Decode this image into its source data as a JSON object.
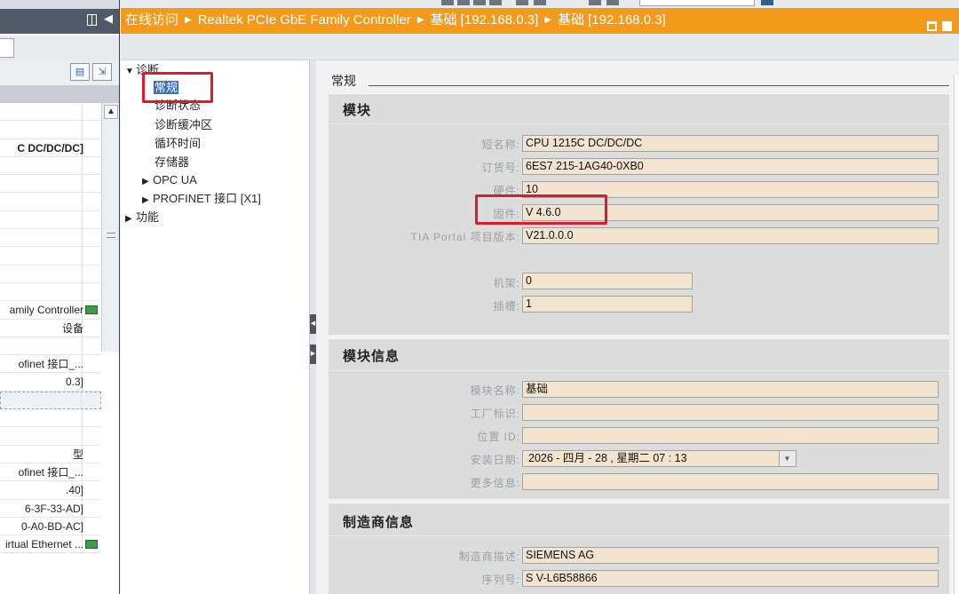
{
  "left_panel": {
    "rows": [
      {
        "text": "",
        "bold": false
      },
      {
        "text": "",
        "bold": false
      },
      {
        "text": "C DC/DC/DC]",
        "bold": true
      },
      {
        "text": "",
        "bold": false
      },
      {
        "text": "",
        "bold": false
      },
      {
        "text": "",
        "bold": false
      },
      {
        "text": "",
        "bold": false
      },
      {
        "text": "",
        "bold": false
      },
      {
        "text": "",
        "bold": false
      },
      {
        "text": "",
        "bold": false
      },
      {
        "text": "",
        "bold": false
      },
      {
        "text": "amily Controller",
        "bold": false,
        "eth": true
      },
      {
        "text": "设备",
        "bold": false
      },
      {
        "text": "",
        "bold": false
      },
      {
        "text": "ofinet 接口_...",
        "bold": false
      },
      {
        "text": "0.3]",
        "bold": false
      },
      {
        "text": "",
        "bold": false,
        "selected": true
      },
      {
        "text": "",
        "bold": false
      },
      {
        "text": "",
        "bold": false
      },
      {
        "text": "型",
        "bold": false
      },
      {
        "text": "ofinet 接口_...",
        "bold": false
      },
      {
        "text": ".40]",
        "bold": false
      },
      {
        "text": "6-3F-33-AD]",
        "bold": false
      },
      {
        "text": "0-A0-BD-AC]",
        "bold": false
      },
      {
        "text": "irtual Ethernet ...",
        "bold": false,
        "eth": true
      }
    ]
  },
  "titlebar": {
    "crumb1": "在线访问",
    "crumb2": "Realtek PCIe GbE Family Controller",
    "crumb3": "基础 [192.168.0.3]",
    "crumb4": "基础 [192.168.0.3]"
  },
  "nav": {
    "diagnostics": "诊断",
    "general": "常规",
    "diag_status": "诊断状态",
    "diag_buffer": "诊断缓冲区",
    "cycle_time": "循环时间",
    "memory": "存储器",
    "opc_ua": "OPC UA",
    "profinet": "PROFINET 接口 [X1]",
    "functions": "功能"
  },
  "content": {
    "section_title": "常规",
    "module": {
      "title": "模块",
      "short_name_label": "短名称:",
      "short_name": "CPU 1215C DC/DC/DC",
      "order_no_label": "订货号:",
      "order_no": "6ES7 215-1AG40-0XB0",
      "hardware_label": "硬件:",
      "hardware": "10",
      "firmware_label": "固件:",
      "firmware": "V 4.6.0",
      "tia_label": "TIA Portal 项目版本:",
      "tia": "V21.0.0.0",
      "rack_label": "机架:",
      "rack": "0",
      "slot_label": "插槽:",
      "slot": "1"
    },
    "module_info": {
      "title": "模块信息",
      "name_label": "模块名称:",
      "name": "基础",
      "plant_label": "工厂标识:",
      "plant": "",
      "location_label": "位置 ID:",
      "location": "",
      "install_label": "安装日期:",
      "install": "2026 - 四月  - 28 ,  星期二   07 : 13",
      "more_label": "更多信息:",
      "more": ""
    },
    "manufacturer": {
      "title": "制造商信息",
      "desc_label": "制造商描述:",
      "desc": "SIEMENS AG",
      "serial_label": "序列号:",
      "serial": "S V-L6B58866"
    }
  },
  "colors": {
    "titlebar": "#f29a1b",
    "highlight_box": "#e0192b",
    "field_bg": "#f3e4cf",
    "selection": "#3d6fc9"
  }
}
